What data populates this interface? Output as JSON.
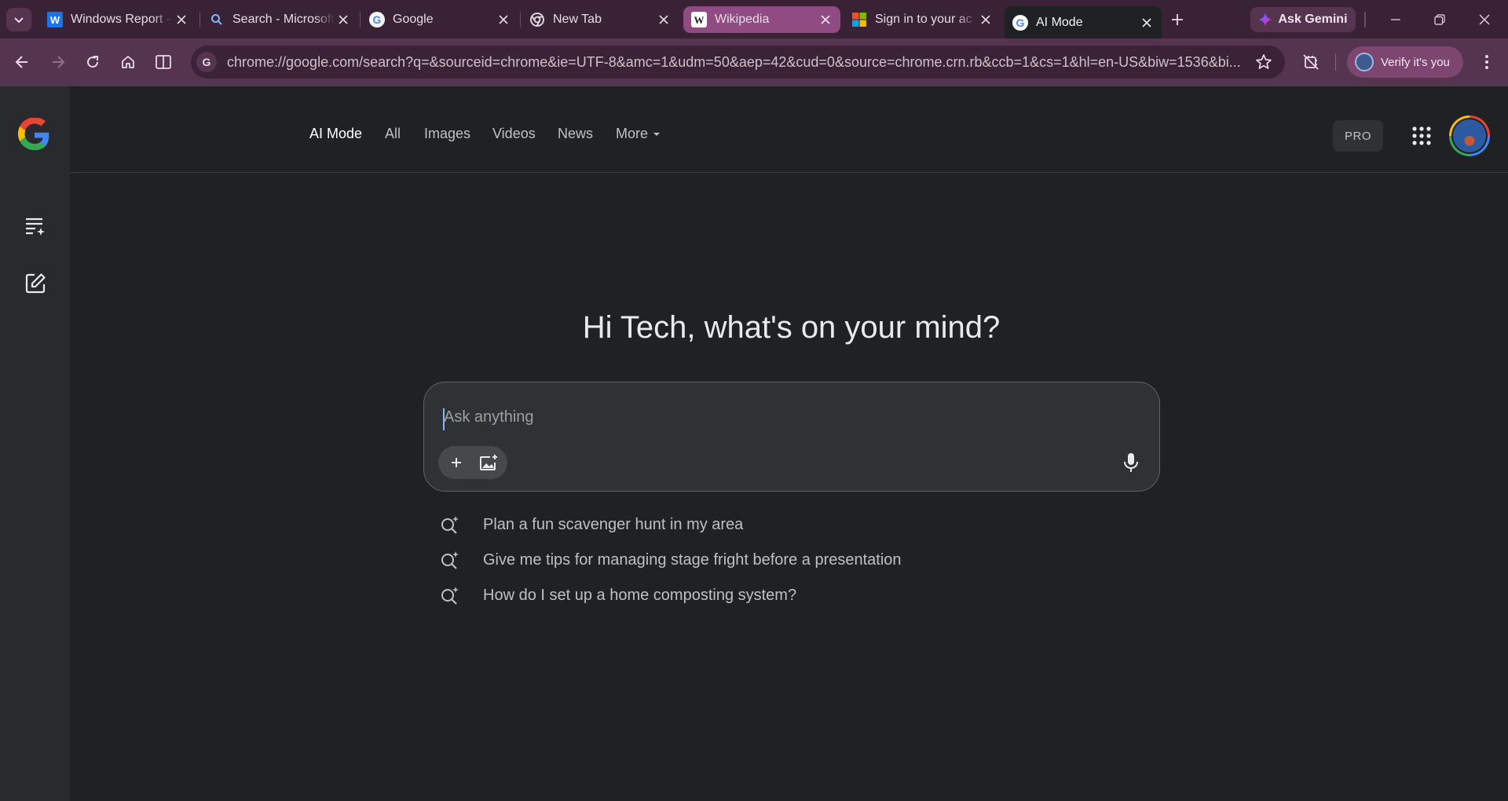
{
  "browser": {
    "tabs": [
      {
        "title": "Windows Report -",
        "favicon": "windows-report-icon",
        "state": "normal"
      },
      {
        "title": "Search - Microsoft",
        "favicon": "search-icon",
        "state": "normal"
      },
      {
        "title": "Google",
        "favicon": "google-icon",
        "state": "normal"
      },
      {
        "title": "New Tab",
        "favicon": "chrome-icon",
        "state": "normal"
      },
      {
        "title": "Wikipedia",
        "favicon": "wikipedia-icon",
        "state": "highlighted"
      },
      {
        "title": "Sign in to your ac",
        "favicon": "microsoft-icon",
        "state": "normal"
      },
      {
        "title": "AI Mode",
        "favicon": "google-icon",
        "state": "active"
      }
    ],
    "ask_gemini_label": "Ask Gemini",
    "url": "chrome://google.com/search?q=&sourceid=chrome&ie=UTF-8&amc=1&udm=50&aep=42&cud=0&source=chrome.crn.rb&ccb=1&cs=1&hl=en-US&biw=1536&bi...",
    "verify_label": "Verify it's you"
  },
  "page": {
    "nav": {
      "items": [
        "AI Mode",
        "All",
        "Images",
        "Videos",
        "News"
      ],
      "more_label": "More",
      "pro_label": "PRO"
    },
    "greeting": "Hi Tech, what's on your mind?",
    "search": {
      "placeholder": "Ask anything"
    },
    "suggestions": [
      "Plan a fun scavenger hunt in my area",
      "Give me tips for managing stage fright before a presentation",
      "How do I set up a home composting system?"
    ]
  },
  "colors": {
    "tabstrip": "#3a2236",
    "toolbar": "#54344e",
    "page_bg": "#202124",
    "accent_caret": "#8ab4f8"
  }
}
